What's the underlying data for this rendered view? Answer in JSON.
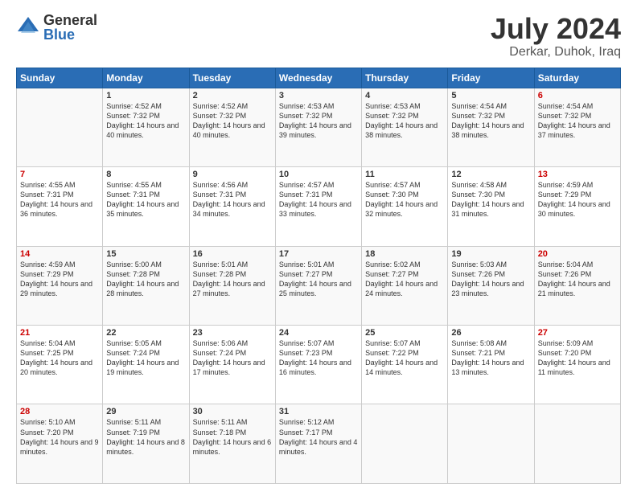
{
  "logo": {
    "general": "General",
    "blue": "Blue"
  },
  "title": "July 2024",
  "location": "Derkar, Duhok, Iraq",
  "header_days": [
    "Sunday",
    "Monday",
    "Tuesday",
    "Wednesday",
    "Thursday",
    "Friday",
    "Saturday"
  ],
  "weeks": [
    [
      {
        "day": "",
        "sunrise": "",
        "sunset": "",
        "daylight": ""
      },
      {
        "day": "1",
        "sunrise": "Sunrise: 4:52 AM",
        "sunset": "Sunset: 7:32 PM",
        "daylight": "Daylight: 14 hours and 40 minutes."
      },
      {
        "day": "2",
        "sunrise": "Sunrise: 4:52 AM",
        "sunset": "Sunset: 7:32 PM",
        "daylight": "Daylight: 14 hours and 40 minutes."
      },
      {
        "day": "3",
        "sunrise": "Sunrise: 4:53 AM",
        "sunset": "Sunset: 7:32 PM",
        "daylight": "Daylight: 14 hours and 39 minutes."
      },
      {
        "day": "4",
        "sunrise": "Sunrise: 4:53 AM",
        "sunset": "Sunset: 7:32 PM",
        "daylight": "Daylight: 14 hours and 38 minutes."
      },
      {
        "day": "5",
        "sunrise": "Sunrise: 4:54 AM",
        "sunset": "Sunset: 7:32 PM",
        "daylight": "Daylight: 14 hours and 38 minutes."
      },
      {
        "day": "6",
        "sunrise": "Sunrise: 4:54 AM",
        "sunset": "Sunset: 7:32 PM",
        "daylight": "Daylight: 14 hours and 37 minutes."
      }
    ],
    [
      {
        "day": "7",
        "sunrise": "Sunrise: 4:55 AM",
        "sunset": "Sunset: 7:31 PM",
        "daylight": "Daylight: 14 hours and 36 minutes."
      },
      {
        "day": "8",
        "sunrise": "Sunrise: 4:55 AM",
        "sunset": "Sunset: 7:31 PM",
        "daylight": "Daylight: 14 hours and 35 minutes."
      },
      {
        "day": "9",
        "sunrise": "Sunrise: 4:56 AM",
        "sunset": "Sunset: 7:31 PM",
        "daylight": "Daylight: 14 hours and 34 minutes."
      },
      {
        "day": "10",
        "sunrise": "Sunrise: 4:57 AM",
        "sunset": "Sunset: 7:31 PM",
        "daylight": "Daylight: 14 hours and 33 minutes."
      },
      {
        "day": "11",
        "sunrise": "Sunrise: 4:57 AM",
        "sunset": "Sunset: 7:30 PM",
        "daylight": "Daylight: 14 hours and 32 minutes."
      },
      {
        "day": "12",
        "sunrise": "Sunrise: 4:58 AM",
        "sunset": "Sunset: 7:30 PM",
        "daylight": "Daylight: 14 hours and 31 minutes."
      },
      {
        "day": "13",
        "sunrise": "Sunrise: 4:59 AM",
        "sunset": "Sunset: 7:29 PM",
        "daylight": "Daylight: 14 hours and 30 minutes."
      }
    ],
    [
      {
        "day": "14",
        "sunrise": "Sunrise: 4:59 AM",
        "sunset": "Sunset: 7:29 PM",
        "daylight": "Daylight: 14 hours and 29 minutes."
      },
      {
        "day": "15",
        "sunrise": "Sunrise: 5:00 AM",
        "sunset": "Sunset: 7:28 PM",
        "daylight": "Daylight: 14 hours and 28 minutes."
      },
      {
        "day": "16",
        "sunrise": "Sunrise: 5:01 AM",
        "sunset": "Sunset: 7:28 PM",
        "daylight": "Daylight: 14 hours and 27 minutes."
      },
      {
        "day": "17",
        "sunrise": "Sunrise: 5:01 AM",
        "sunset": "Sunset: 7:27 PM",
        "daylight": "Daylight: 14 hours and 25 minutes."
      },
      {
        "day": "18",
        "sunrise": "Sunrise: 5:02 AM",
        "sunset": "Sunset: 7:27 PM",
        "daylight": "Daylight: 14 hours and 24 minutes."
      },
      {
        "day": "19",
        "sunrise": "Sunrise: 5:03 AM",
        "sunset": "Sunset: 7:26 PM",
        "daylight": "Daylight: 14 hours and 23 minutes."
      },
      {
        "day": "20",
        "sunrise": "Sunrise: 5:04 AM",
        "sunset": "Sunset: 7:26 PM",
        "daylight": "Daylight: 14 hours and 21 minutes."
      }
    ],
    [
      {
        "day": "21",
        "sunrise": "Sunrise: 5:04 AM",
        "sunset": "Sunset: 7:25 PM",
        "daylight": "Daylight: 14 hours and 20 minutes."
      },
      {
        "day": "22",
        "sunrise": "Sunrise: 5:05 AM",
        "sunset": "Sunset: 7:24 PM",
        "daylight": "Daylight: 14 hours and 19 minutes."
      },
      {
        "day": "23",
        "sunrise": "Sunrise: 5:06 AM",
        "sunset": "Sunset: 7:24 PM",
        "daylight": "Daylight: 14 hours and 17 minutes."
      },
      {
        "day": "24",
        "sunrise": "Sunrise: 5:07 AM",
        "sunset": "Sunset: 7:23 PM",
        "daylight": "Daylight: 14 hours and 16 minutes."
      },
      {
        "day": "25",
        "sunrise": "Sunrise: 5:07 AM",
        "sunset": "Sunset: 7:22 PM",
        "daylight": "Daylight: 14 hours and 14 minutes."
      },
      {
        "day": "26",
        "sunrise": "Sunrise: 5:08 AM",
        "sunset": "Sunset: 7:21 PM",
        "daylight": "Daylight: 14 hours and 13 minutes."
      },
      {
        "day": "27",
        "sunrise": "Sunrise: 5:09 AM",
        "sunset": "Sunset: 7:20 PM",
        "daylight": "Daylight: 14 hours and 11 minutes."
      }
    ],
    [
      {
        "day": "28",
        "sunrise": "Sunrise: 5:10 AM",
        "sunset": "Sunset: 7:20 PM",
        "daylight": "Daylight: 14 hours and 9 minutes."
      },
      {
        "day": "29",
        "sunrise": "Sunrise: 5:11 AM",
        "sunset": "Sunset: 7:19 PM",
        "daylight": "Daylight: 14 hours and 8 minutes."
      },
      {
        "day": "30",
        "sunrise": "Sunrise: 5:11 AM",
        "sunset": "Sunset: 7:18 PM",
        "daylight": "Daylight: 14 hours and 6 minutes."
      },
      {
        "day": "31",
        "sunrise": "Sunrise: 5:12 AM",
        "sunset": "Sunset: 7:17 PM",
        "daylight": "Daylight: 14 hours and 4 minutes."
      },
      {
        "day": "",
        "sunrise": "",
        "sunset": "",
        "daylight": ""
      },
      {
        "day": "",
        "sunrise": "",
        "sunset": "",
        "daylight": ""
      },
      {
        "day": "",
        "sunrise": "",
        "sunset": "",
        "daylight": ""
      }
    ]
  ]
}
